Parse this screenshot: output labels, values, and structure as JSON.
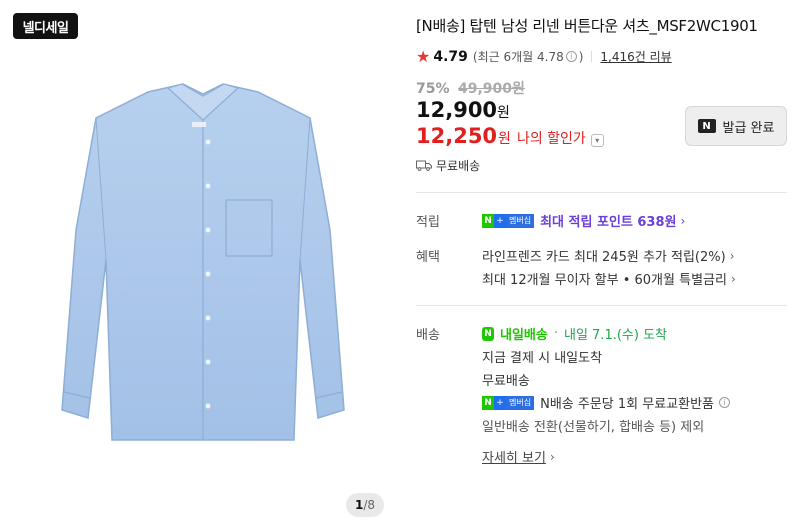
{
  "gallery": {
    "badge": "넬디세일",
    "page_current": "1",
    "page_total": "/8"
  },
  "product": {
    "title": "[N배송] 탑텐 남성 리넨 버튼다운 셔츠_MSF2WC1901",
    "rating": "4.79",
    "recent_rating": "(최근 6개월 4.78",
    "recent_rating_close": ")",
    "review_count": "1,416건 리뷰",
    "discount_rate": "75%",
    "original_price": "49,900원",
    "price": "12,900",
    "price_unit": "원",
    "my_price": "12,250",
    "my_price_unit": "원",
    "my_price_label": "나의 할인가",
    "issue_button": "발급 완료",
    "issue_icon": "N",
    "free_shipping": "무료배송"
  },
  "points": {
    "label": "적립",
    "badge_n": "N",
    "badge_plus": "+",
    "badge_text": "멤버십",
    "text": "최대 적립 포인트 638원"
  },
  "benefits": {
    "label": "혜택",
    "line1": "라인프렌즈 카드 최대 245원 추가 적립(2%)",
    "line2": "최대 12개월 무이자 할부 • 60개월 특별금리"
  },
  "delivery": {
    "label": "배송",
    "tomorrow_label": "내일배송",
    "arrival": "내일 7.1.(수) 도착",
    "line2": "지금 결제 시 내일도착",
    "line3": "무료배송",
    "badge_n": "N",
    "badge_plus": "+",
    "badge_text": "멤버십",
    "line4": "N배송 주문당 1회 무료교환반품",
    "line5": "일반배송 전환(선물하기, 합배송 등) 제외",
    "more": "자세히 보기"
  },
  "colors": {
    "accent_red": "#e0201f",
    "naver_green": "#1ec800",
    "membership_purple": "#6a3fd8",
    "shirt_blue": "#a9c6e8"
  }
}
